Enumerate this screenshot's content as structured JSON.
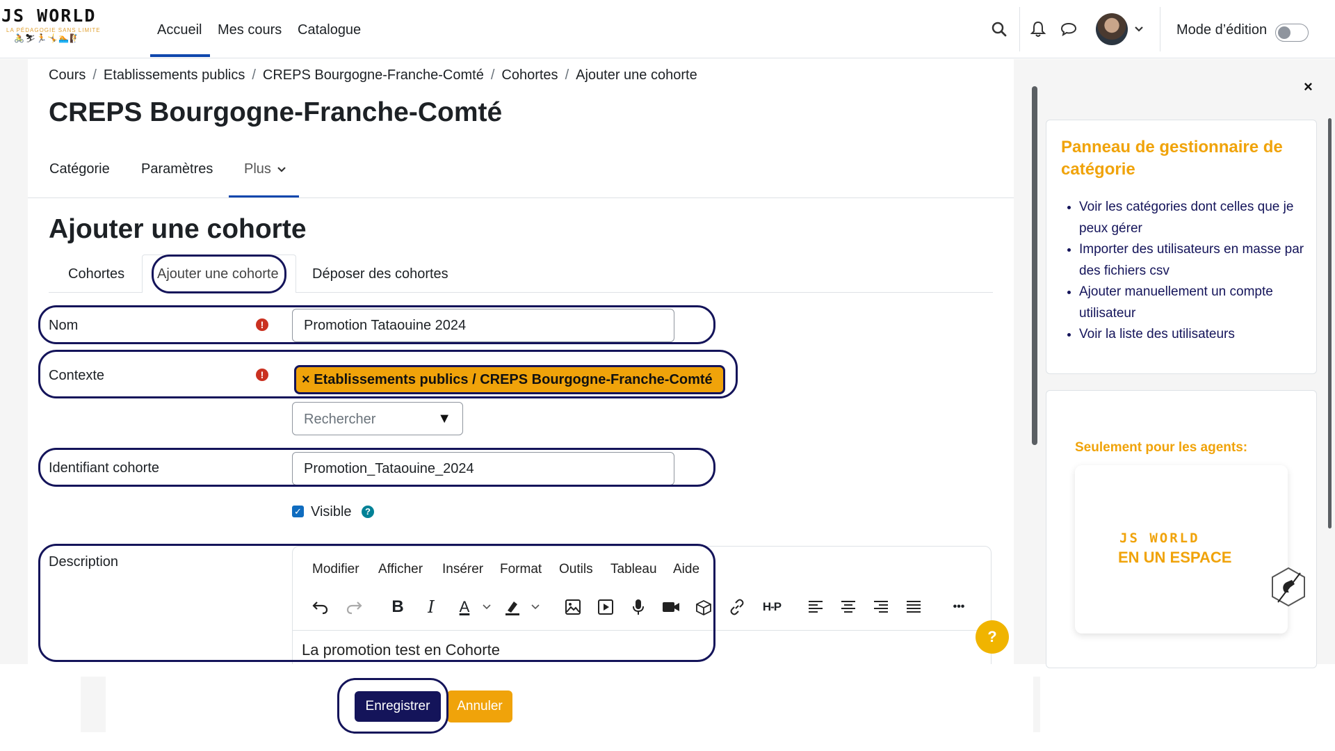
{
  "logo": {
    "brand": "JS WORLD",
    "tagline": "LA PÉDAGOGIE SANS LIMITE",
    "figures": "🚴⛷🏃🤸🏊🧗"
  },
  "navbar": {
    "links": [
      "Accueil",
      "Mes cours",
      "Catalogue"
    ],
    "active": "Accueil",
    "edit_mode_label": "Mode d’édition"
  },
  "breadcrumb": [
    "Cours",
    "Etablissements publics",
    "CREPS Bourgogne-Franche-Comté",
    "Cohortes",
    "Ajouter une cohorte"
  ],
  "page_title": "CREPS Bourgogne-Franche-Comté",
  "secondary_nav": {
    "items": [
      "Catégorie",
      "Paramètres",
      "Plus"
    ],
    "active": "Plus"
  },
  "form_title": "Ajouter une cohorte",
  "tabs": {
    "items": [
      "Cohortes",
      "Ajouter une cohorte",
      "Déposer des cohortes"
    ],
    "active": "Ajouter une cohorte"
  },
  "form": {
    "name": {
      "label": "Nom",
      "value": "Promotion Tataouine 2024"
    },
    "context": {
      "label": "Contexte",
      "selected": "× Etablissements publics / CREPS Bourgogne-Franche-Comté",
      "search_placeholder": "Rechercher"
    },
    "idnumber": {
      "label": "Identifiant cohorte",
      "value": "Promotion_Tataouine_2024"
    },
    "visible": {
      "label": "Visible",
      "checked": true
    },
    "description": {
      "label": "Description",
      "menu": [
        "Modifier",
        "Afficher",
        "Insérer",
        "Format",
        "Outils",
        "Tableau",
        "Aide"
      ],
      "toolbar_icons": [
        "undo-icon",
        "redo-icon",
        "bold-icon",
        "italic-icon",
        "text-color-icon",
        "highlight-icon",
        "image-icon",
        "media-icon",
        "microphone-icon",
        "video-camera-icon",
        "block-icon",
        "link-icon",
        "h5p-icon",
        "align-left-icon",
        "align-center-icon",
        "align-right-icon",
        "justify-icon",
        "more-icon"
      ],
      "bold_glyph": "B",
      "italic_glyph": "I",
      "text_color_glyph": "A",
      "h5p_glyph": "H-P",
      "more_glyph": "•••",
      "content": "La promotion test en Cohorte"
    }
  },
  "buttons": {
    "save": "Enregistrer",
    "cancel": "Annuler"
  },
  "help_fab": "?",
  "drawer": {
    "close": "×",
    "panel_title": "Panneau de gestionnaire de catégorie",
    "links": [
      "Voir les catégories dont celles que je peux gérer",
      "Importer des utilisateurs en masse par des fichiers csv",
      "Ajouter manuellement un compte utilisateur",
      "Voir la liste des utilisateurs"
    ],
    "agents_title": "Seulement pour les agents:",
    "promo_brand": "JS WORLD",
    "promo_tagline": "EN UN ESPACE"
  },
  "colors": {
    "accent": "#f0a30a",
    "primary": "#14145a",
    "required": "#ca3120"
  }
}
